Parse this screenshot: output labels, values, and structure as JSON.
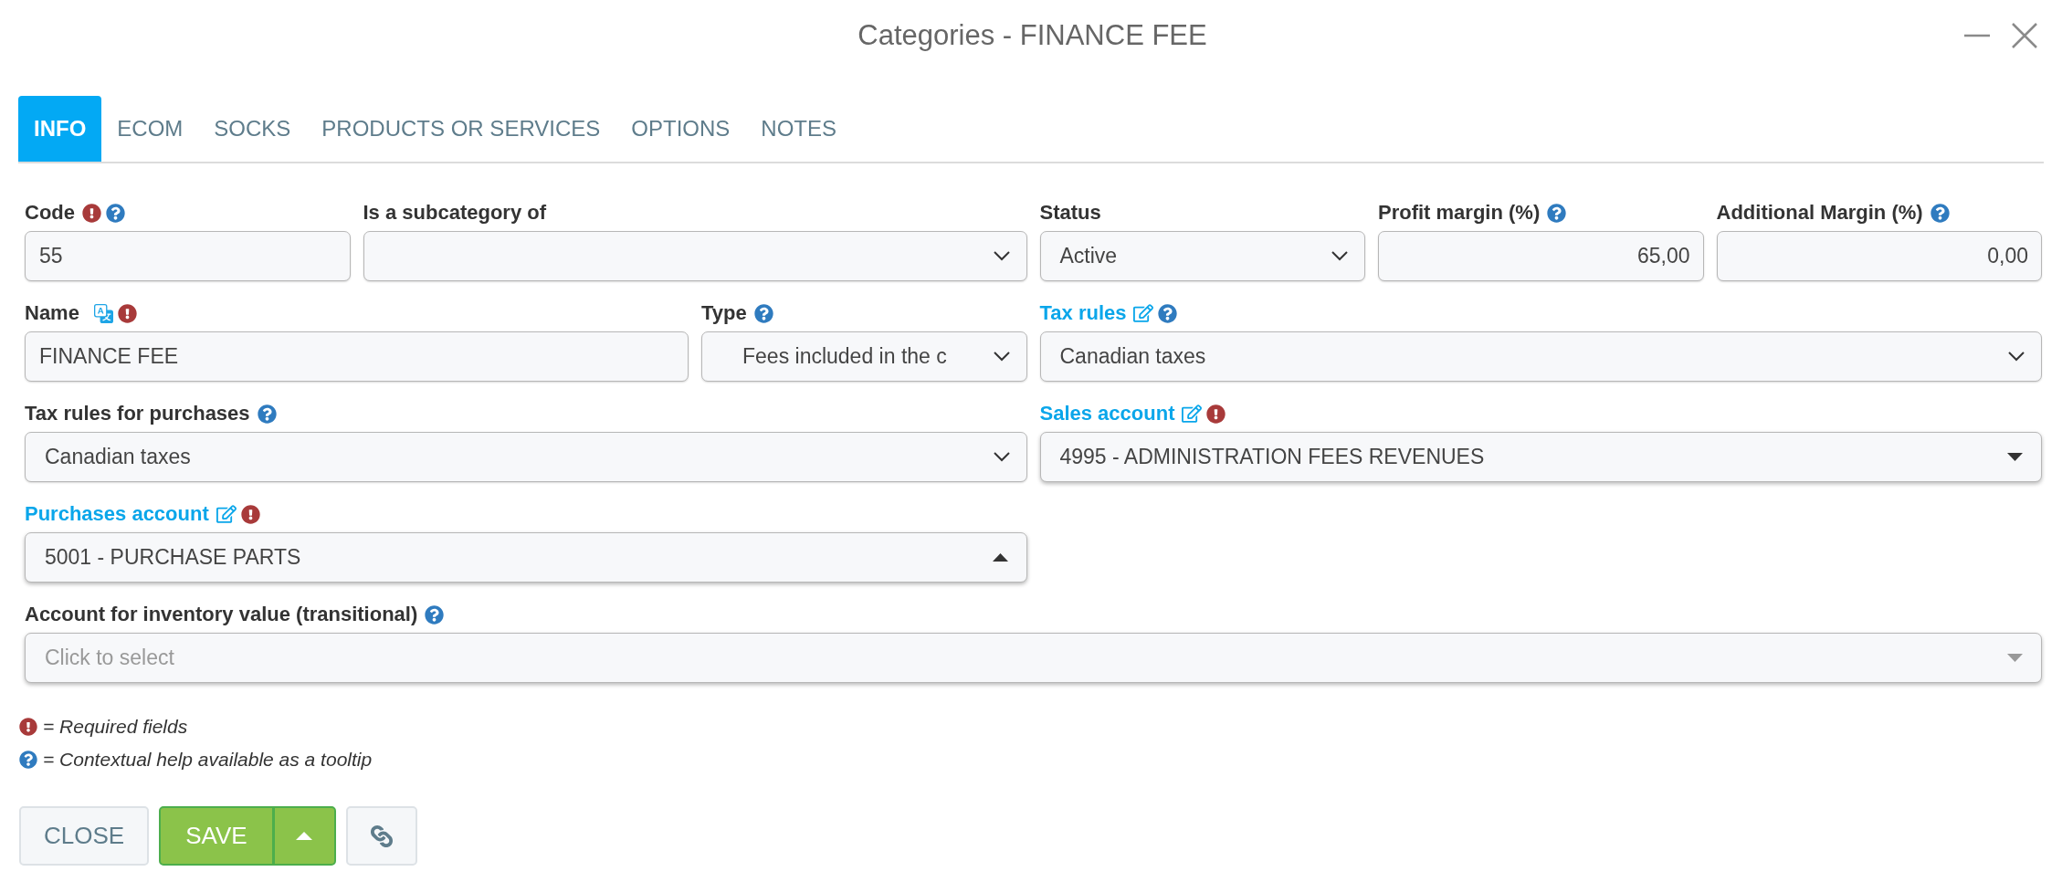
{
  "window": {
    "title": "Categories - FINANCE FEE"
  },
  "tabs": [
    {
      "label": "INFO",
      "selected": true
    },
    {
      "label": "ECOM",
      "selected": false
    },
    {
      "label": "SOCKS",
      "selected": false
    },
    {
      "label": "PRODUCTS OR SERVICES",
      "selected": false
    },
    {
      "label": "OPTIONS",
      "selected": false
    },
    {
      "label": "NOTES",
      "selected": false
    }
  ],
  "fields": [
    {
      "kind": "text",
      "label": "Code",
      "value": "55",
      "required": true,
      "help": true,
      "linked": false,
      "translatable": false
    },
    {
      "kind": "select",
      "label": "Is a subcategory of",
      "required": false,
      "help": false,
      "linked": false,
      "translatable": false,
      "expanded": false
    },
    {
      "kind": "select",
      "label": "Status",
      "value": "Active",
      "required": false,
      "help": false,
      "linked": false,
      "translatable": false,
      "expanded": false
    },
    {
      "kind": "number",
      "label": "Profit margin (%)",
      "value": "65,00",
      "required": false,
      "help": true,
      "linked": false,
      "translatable": false
    },
    {
      "kind": "number",
      "label": "Additional Margin (%)",
      "value": "0,00",
      "required": false,
      "help": true,
      "linked": false,
      "translatable": false
    },
    {
      "kind": "text",
      "label": "Name",
      "value": "FINANCE FEE",
      "required": true,
      "help": false,
      "linked": false,
      "translatable": true
    },
    {
      "kind": "select",
      "label": "Type",
      "value": "Fees included in the c",
      "required": false,
      "help": true,
      "linked": false,
      "translatable": false,
      "expanded": false
    },
    {
      "kind": "select",
      "label": "Tax rules",
      "value": "Canadian taxes",
      "required": false,
      "help": true,
      "linked": true,
      "translatable": false,
      "expanded": false
    },
    {
      "kind": "select",
      "label": "Tax rules for purchases",
      "value": "Canadian taxes",
      "required": false,
      "help": true,
      "linked": false,
      "translatable": false,
      "expanded": false
    },
    {
      "kind": "combo",
      "label": "Sales account",
      "value": "4995 - ADMINISTRATION FEES REVENUES",
      "required": true,
      "help": false,
      "linked": true,
      "translatable": false,
      "expanded": false
    },
    {
      "kind": "combo",
      "label": "Purchases account",
      "value": "5001 - PURCHASE PARTS",
      "required": true,
      "help": false,
      "linked": true,
      "translatable": false,
      "expanded": true
    },
    {
      "kind": "combo",
      "label": "Account for inventory value (transitional)",
      "placeholder": "Click to select",
      "required": false,
      "help": true,
      "linked": false,
      "translatable": false,
      "expanded": false
    }
  ],
  "legend": [
    {
      "kind": "required",
      "text": "= Required fields"
    },
    {
      "kind": "help",
      "text": "= Contextual help available as a tooltip"
    }
  ],
  "buttons": [
    {
      "kind": "close",
      "label": "CLOSE"
    },
    {
      "kind": "save",
      "label": "SAVE"
    },
    {
      "kind": "link"
    }
  ]
}
